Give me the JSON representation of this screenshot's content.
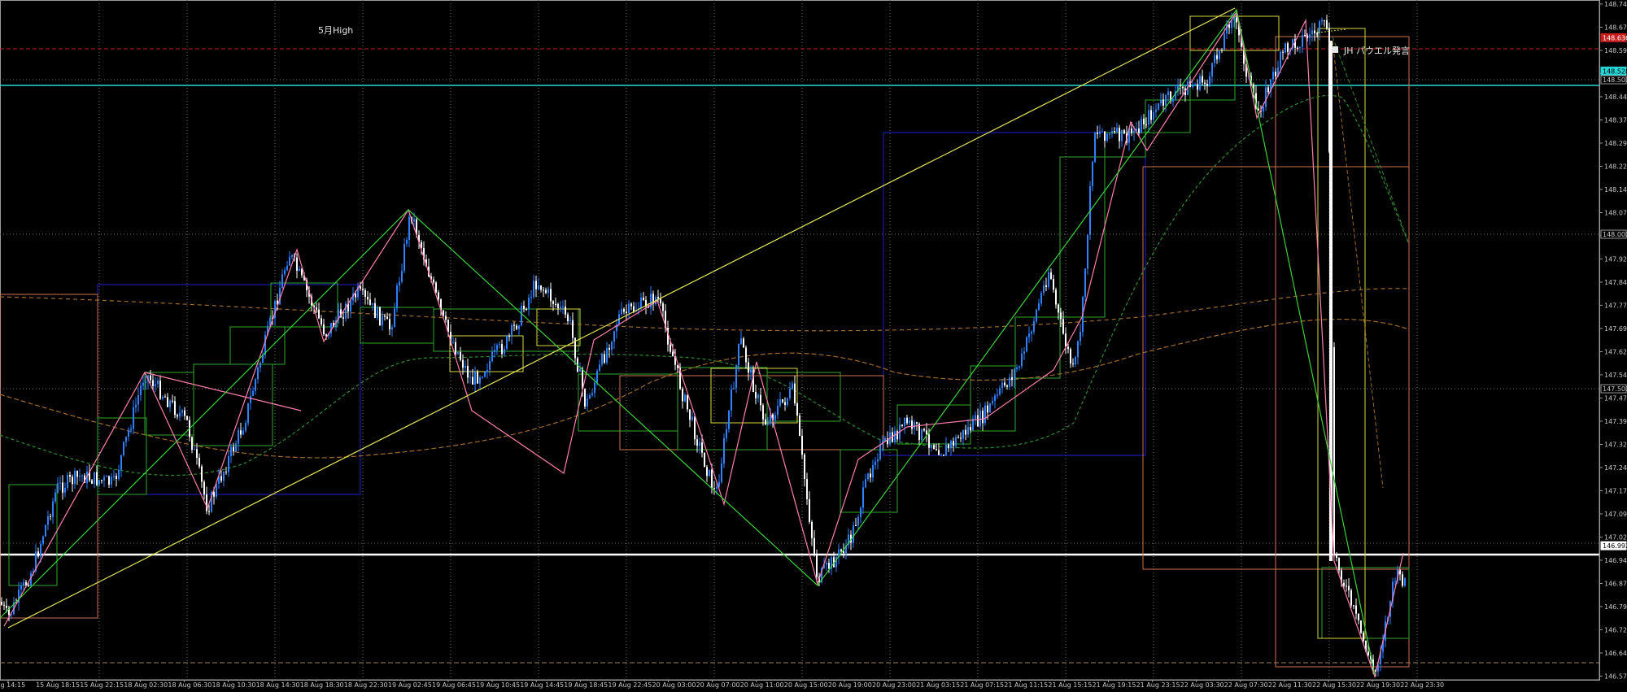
{
  "annotations": {
    "month_high": "5月High",
    "event_badge": "JH パウエル発言"
  },
  "colors": {
    "background": "#000000",
    "grid": "#6e6e6e",
    "bull_candle": "#2f7fff",
    "bear_candle": "#ffffff",
    "zigzag_pink": "#ff7fb0",
    "zigzag_green": "#3cd23c",
    "trend_yellow": "#e6e65a",
    "box_green": "#2fa82f",
    "box_blue": "#1f1fcf",
    "box_salmon": "#d07050",
    "box_yellow": "#d8d840",
    "cyan_line": "#25d6d6",
    "red_dash": "#c81e1e",
    "ma_orange": "#a06a2a",
    "ma_green": "#2d8a2d"
  },
  "time_labels": [
    "Aug 14:15",
    "15 Aug 18:15",
    "15 Aug 22:15",
    "18 Aug 02:30",
    "18 Aug 06:30",
    "18 Aug 10:30",
    "18 Aug 14:30",
    "18 Aug 18:30",
    "18 Aug 22:30",
    "19 Aug 02:45",
    "19 Aug 06:45",
    "19 Aug 10:45",
    "19 Aug 14:45",
    "19 Aug 18:45",
    "19 Aug 22:45",
    "20 Aug 03:00",
    "20 Aug 07:00",
    "20 Aug 11:00",
    "20 Aug 15:00",
    "20 Aug 19:00",
    "20 Aug 23:00",
    "21 Aug 03:15",
    "21 Aug 07:15",
    "21 Aug 11:15",
    "21 Aug 15:15",
    "21 Aug 19:15",
    "21 Aug 23:15",
    "22 Aug 03:30",
    "22 Aug 07:30",
    "22 Aug 11:30",
    "22 Aug 15:30",
    "22 Aug 19:30",
    "22 Aug 23:30"
  ],
  "price_labels": [
    "148.745",
    "148.670",
    "148.595",
    "148.520",
    "148.445",
    "148.370",
    "148.295",
    "148.220",
    "148.145",
    "148.070",
    "147.995",
    "147.920",
    "147.845",
    "147.770",
    "147.695",
    "147.620",
    "147.545",
    "147.470",
    "147.395",
    "147.320",
    "147.245",
    "147.170",
    "147.095",
    "147.020",
    "146.945",
    "146.870",
    "146.795",
    "146.720",
    "146.645",
    "146.570"
  ],
  "price_tags": [
    {
      "text": "148.636",
      "bg": "#c81e1e",
      "fg": "#ffffff",
      "price": 148.636
    },
    {
      "text": "148.528",
      "bg": "#25d6d6",
      "fg": "#000000",
      "price": 148.528
    },
    {
      "text": "148.500",
      "bg": "#000000",
      "fg": "#c8c8c8",
      "price": 148.5
    },
    {
      "text": "148.000",
      "bg": "#000000",
      "fg": "#c8c8c8",
      "price": 148.0
    },
    {
      "text": "147.500",
      "bg": "#000000",
      "fg": "#c8c8c8",
      "price": 147.5
    },
    {
      "text": "146.992",
      "bg": "#ffffff",
      "fg": "#000000",
      "price": 146.992
    }
  ]
}
